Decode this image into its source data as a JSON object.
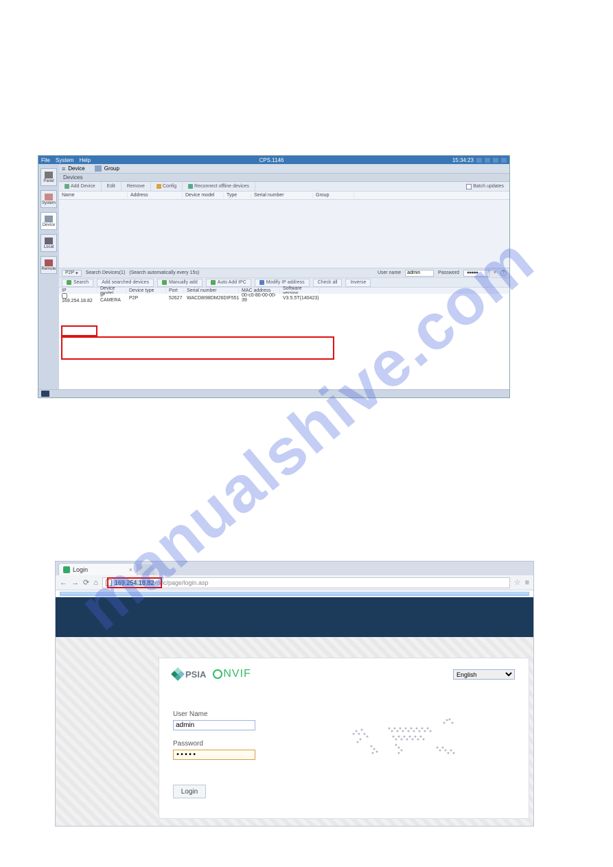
{
  "watermark": "manualshive.com",
  "cms": {
    "menus": {
      "file": "File",
      "system": "System",
      "help": "Help"
    },
    "title": "CPS.1146",
    "time": "15:34:23",
    "leftnav": {
      "panel": "Panel",
      "system": "System",
      "device": "Device",
      "local": "Local",
      "remote": "Remote"
    },
    "tabs": {
      "device": "Device",
      "group": "Group"
    },
    "sub": "Devices",
    "toolbar": {
      "addDevice": "Add Device",
      "edit": "Edit",
      "remove": "Remove",
      "config": "Config",
      "reconnect": "Reconnect offline devices",
      "batch": "Batch updates"
    },
    "cols": {
      "name": "Name",
      "address": "Address",
      "model": "Device model",
      "type": "Type",
      "serial": "Serial number",
      "group": "Group"
    },
    "searchbar": {
      "p2p": "P2P",
      "countLabel": "Search Devices(1)",
      "hint": "(Search automatically every 15s)",
      "userNameLbl": "User name",
      "userName": "admin",
      "passwordLbl": "Password",
      "passwordDots": "●●●●●",
      "help": "?"
    },
    "searchActions": {
      "search": "Search",
      "addSearched": "Add searched devices",
      "manually": "Manually add",
      "autoAdd": "Auto Add IPC",
      "modifyIp": "Modify IP address",
      "checkAll": "Check all",
      "inverse": "Inverse"
    },
    "resCols": {
      "ip": "IP",
      "dm": "Device model",
      "dt": "Device type",
      "port": "Port",
      "sn": "Serial number",
      "mac": "MAC address",
      "sv": "Software version"
    },
    "resRow": {
      "ip": "169.254.18.82",
      "dm": "IP CAMERA",
      "dt": "P2P",
      "port": "52627",
      "sn": "WACD8I98DM26DIF551",
      "mac": "00-c0-80-00-00-39",
      "sv": "V3.5.5T(140423)"
    }
  },
  "browser": {
    "tabTitle": "Login",
    "urlHighlighted": "169.254.18.82",
    "urlTail": "/doc/page/login.asp",
    "logos": {
      "psia": "PSIA",
      "onvif": "NVIF"
    },
    "langOptions": [
      "English"
    ],
    "form": {
      "userLabel": "User Name",
      "userValue": "admin",
      "passwordLabel": "Password",
      "passwordValue": "•••••",
      "loginBtn": "Login"
    }
  }
}
